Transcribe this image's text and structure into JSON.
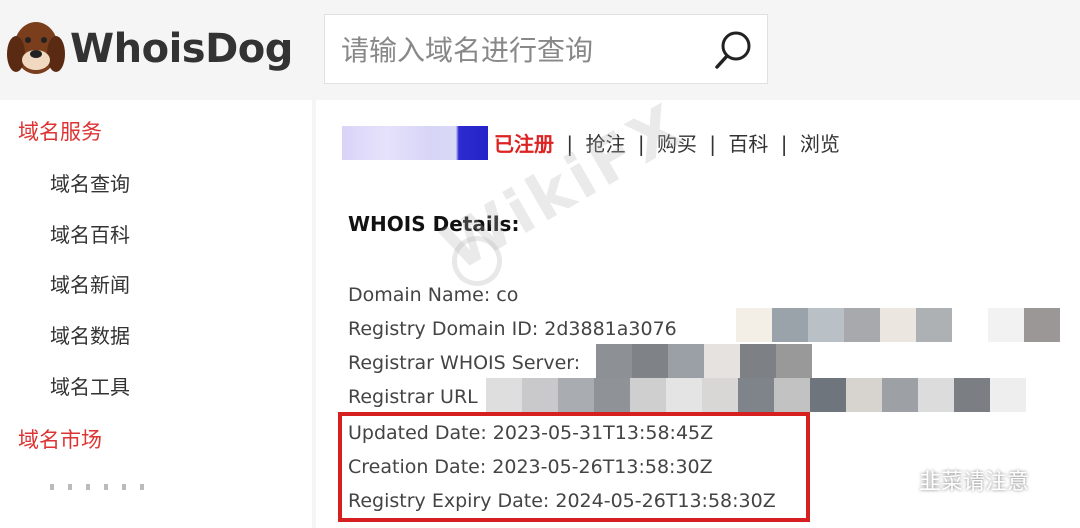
{
  "header": {
    "logo_text": "WhoisDog",
    "search": {
      "placeholder": "请输入域名进行查询",
      "value": ""
    }
  },
  "sidebar": {
    "sections": [
      {
        "title": "域名服务",
        "items": [
          "域名查询",
          "域名百科",
          "域名新闻",
          "域名数据",
          "域名工具"
        ]
      },
      {
        "title": "域名市场",
        "items": []
      }
    ]
  },
  "main": {
    "status": {
      "registered": "已注册",
      "links": [
        "抢注",
        "购买",
        "百科",
        "浏览"
      ],
      "separator": "|"
    },
    "details_title": "WHOIS Details:",
    "lines": [
      "Domain Name: co",
      "Registry Domain ID: 2d3881a3076",
      "Registrar WHOIS Server:",
      "Registrar URL",
      "Updated Date: 2023-05-31T13:58:45Z",
      "Creation Date: 2023-05-26T13:58:30Z",
      "Registry Expiry Date: 2024-05-26T13:58:30Z"
    ]
  },
  "watermark": {
    "text": "WikiFX"
  },
  "wechat_label": "韭菜请注意",
  "colors": {
    "accent_red": "#d6201f",
    "sidebar_red": "#dd3333"
  }
}
